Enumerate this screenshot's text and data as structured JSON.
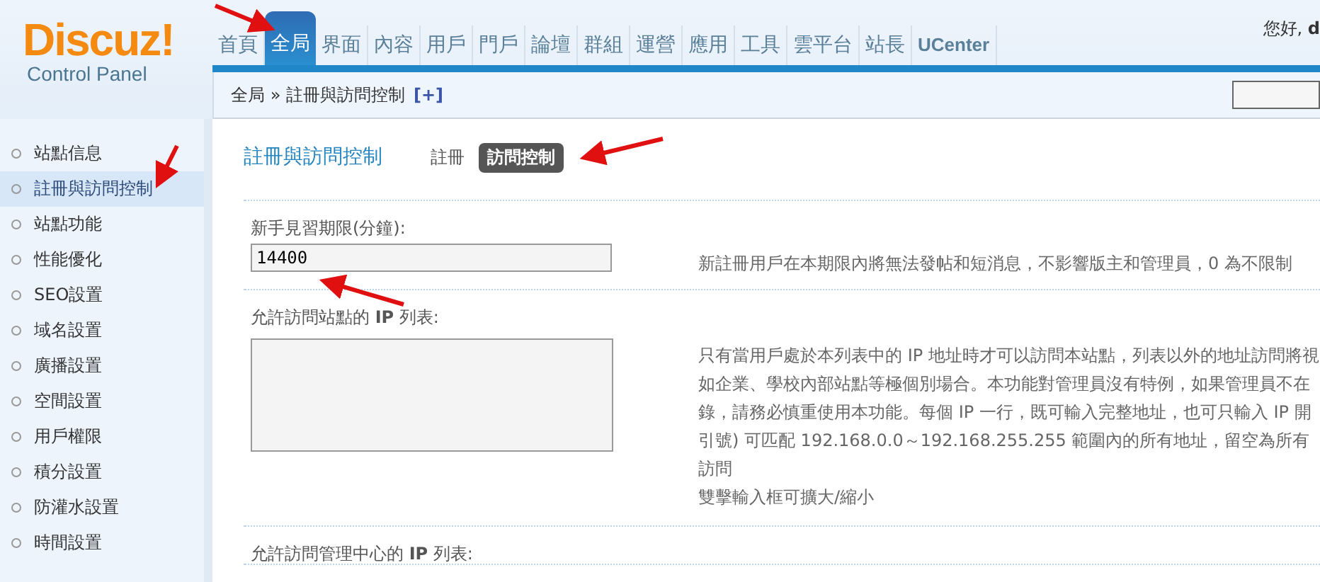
{
  "logo": {
    "title": "Discuz!",
    "subtitle": "Control Panel"
  },
  "nav": [
    {
      "label": "首頁",
      "selected": false
    },
    {
      "label": "全局",
      "selected": true
    },
    {
      "label": "界面",
      "selected": false
    },
    {
      "label": "內容",
      "selected": false
    },
    {
      "label": "用戶",
      "selected": false
    },
    {
      "label": "門戶",
      "selected": false
    },
    {
      "label": "論壇",
      "selected": false
    },
    {
      "label": "群組",
      "selected": false
    },
    {
      "label": "運營",
      "selected": false
    },
    {
      "label": "應用",
      "selected": false
    },
    {
      "label": "工具",
      "selected": false
    },
    {
      "label": "雲平台",
      "selected": false
    },
    {
      "label": "站長",
      "selected": false
    },
    {
      "label": "UCenter",
      "selected": false
    }
  ],
  "greeting": "您好, **d**",
  "breadcrumb": {
    "path": "全局 » 註冊與訪問控制",
    "add": "[+]"
  },
  "sidebar": {
    "items": [
      {
        "label": "站點信息",
        "selected": false
      },
      {
        "label": "註冊與訪問控制",
        "selected": true
      },
      {
        "label": "站點功能",
        "selected": false
      },
      {
        "label": "性能優化",
        "selected": false
      },
      {
        "label": "SEO設置",
        "selected": false
      },
      {
        "label": "域名設置",
        "selected": false
      },
      {
        "label": "廣播設置",
        "selected": false
      },
      {
        "label": "空間設置",
        "selected": false
      },
      {
        "label": "用戶權限",
        "selected": false
      },
      {
        "label": "積分設置",
        "selected": false
      },
      {
        "label": "防灌水設置",
        "selected": false
      },
      {
        "label": "時間設置",
        "selected": false
      }
    ]
  },
  "page": {
    "title": "註冊與訪問控制",
    "tabs": [
      {
        "label": "註冊",
        "selected": false
      },
      {
        "label": "訪問控制",
        "selected": true
      }
    ]
  },
  "settings": [
    {
      "kind": "input",
      "label": "新手見習期限(分鐘):",
      "value": "14400",
      "help": [
        "新註冊用戶在本期限內將無法發帖和短消息，不影響版主和管理員，0 為不限制"
      ]
    },
    {
      "kind": "textarea",
      "label": "允許訪問站點的 **IP** 列表:",
      "help": [
        "只有當用戶處於本列表中的 IP 地址時才可以訪問本站點，列表以外的地址訪問將視",
        "如企業、學校內部站點等極個別場合。本功能對管理員沒有特例，如果管理員不在",
        "錄，請務必慎重使用本功能。每個 IP 一行，既可輸入完整地址，也可只輸入 IP 開",
        "引號) 可匹配 192.168.0.0～192.168.255.255 範圍內的所有地址，留空為所有",
        "訪問",
        "雙擊輸入框可擴大/縮小"
      ]
    },
    {
      "kind": "label",
      "label": "允許訪問管理中心的 **IP** 列表:"
    }
  ]
}
